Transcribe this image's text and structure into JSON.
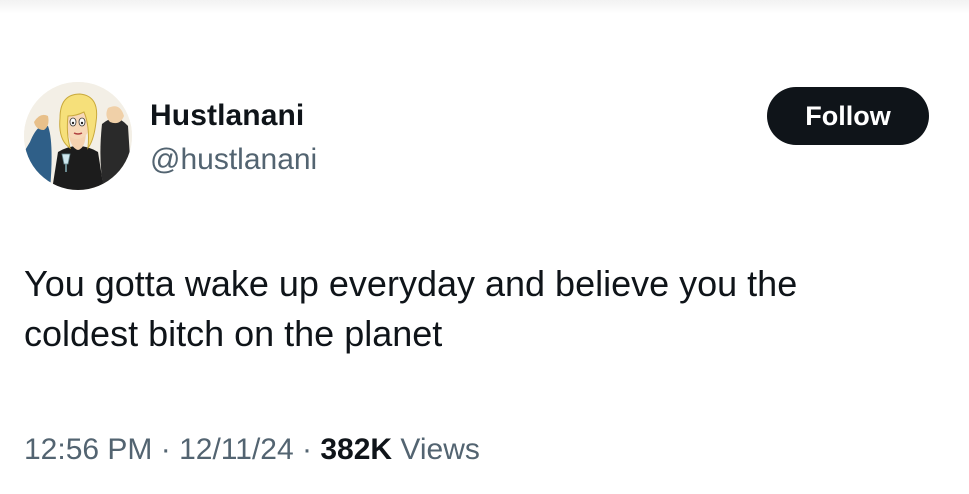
{
  "author": {
    "display_name": "Hustlanani",
    "handle": "@hustlanani",
    "avatar_icon": "cartoon-avatar-icon"
  },
  "actions": {
    "follow_label": "Follow"
  },
  "tweet": {
    "text_line_1": "You gotta wake up everyday and believe you the",
    "text_line_2": "coldest bitch on the planet"
  },
  "meta": {
    "time": "12:56 PM",
    "separator_1": " · ",
    "date": "12/11/24",
    "separator_2": " · ",
    "views_count": "382K",
    "views_label": " Views"
  },
  "colors": {
    "text_primary": "#0f1419",
    "text_secondary": "#536471",
    "follow_bg": "#0f1419",
    "follow_text": "#ffffff",
    "background": "#ffffff"
  }
}
